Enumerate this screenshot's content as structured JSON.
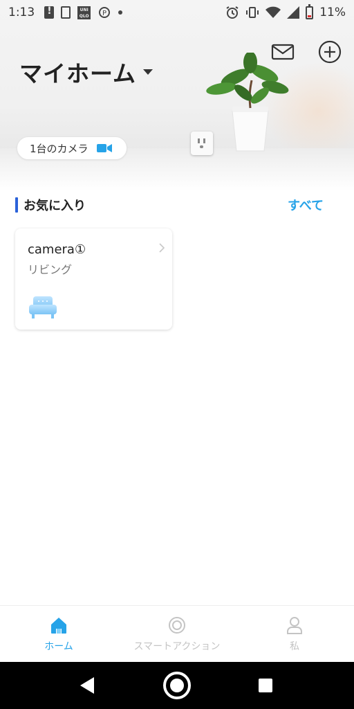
{
  "status_bar": {
    "time": "1:13",
    "battery": "11%"
  },
  "header": {
    "home_title": "マイホーム",
    "camera_chip_label": "1台のカメラ"
  },
  "favorites": {
    "title": "お気に入り",
    "see_all": "すべて",
    "devices": [
      {
        "name": "camera①",
        "room": "リビング"
      }
    ]
  },
  "tabs": [
    {
      "label": "ホーム",
      "active": true
    },
    {
      "label": "スマートアクション",
      "active": false
    },
    {
      "label": "私",
      "active": false
    }
  ],
  "colors": {
    "accent_blue": "#26a3e8",
    "section_bar": "#2b62d9",
    "inactive_tab": "#c4c4c4"
  },
  "icons": [
    "mail-icon",
    "plus-circle-icon",
    "caret-down-icon",
    "video-camera-icon",
    "chevron-right-icon",
    "sofa-icon",
    "home-icon",
    "target-icon",
    "person-icon"
  ]
}
